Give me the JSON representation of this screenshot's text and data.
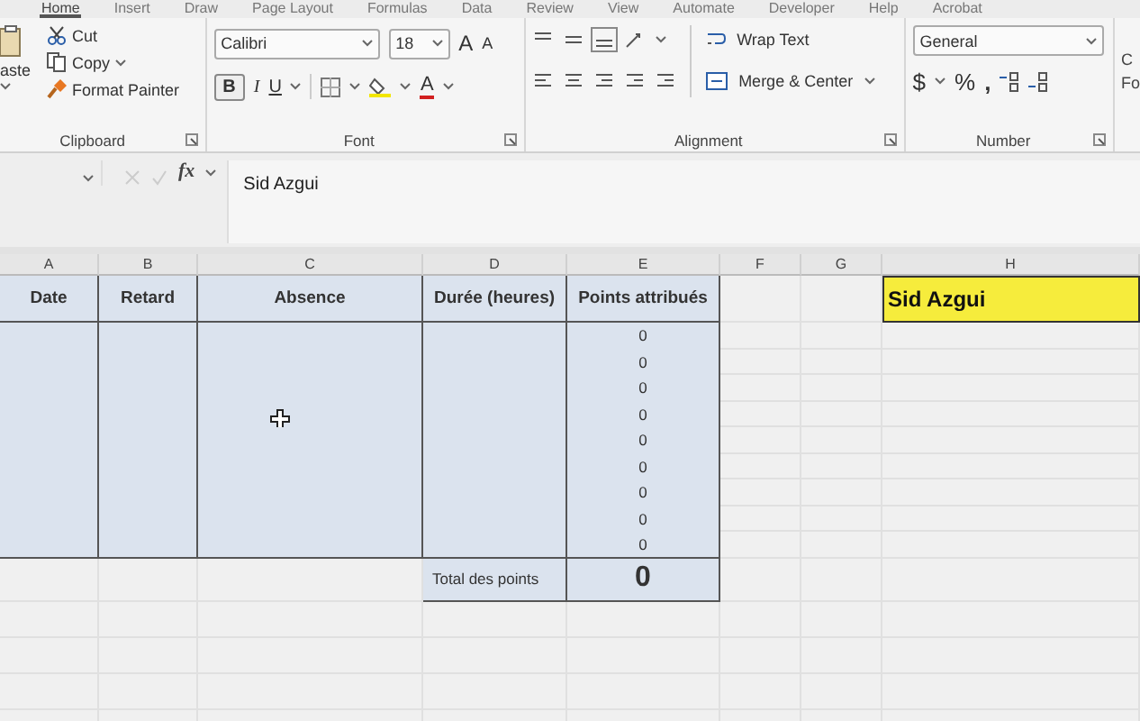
{
  "tabs": [
    {
      "label": "Home",
      "selected": true
    },
    {
      "label": "Insert",
      "selected": false
    },
    {
      "label": "Draw",
      "selected": false
    },
    {
      "label": "Page Layout",
      "selected": false
    },
    {
      "label": "Formulas",
      "selected": false
    },
    {
      "label": "Data",
      "selected": false
    },
    {
      "label": "Review",
      "selected": false
    },
    {
      "label": "View",
      "selected": false
    },
    {
      "label": "Automate",
      "selected": false
    },
    {
      "label": "Developer",
      "selected": false
    },
    {
      "label": "Help",
      "selected": false
    },
    {
      "label": "Acrobat",
      "selected": false
    }
  ],
  "clipboard": {
    "paste": "aste",
    "cut": "Cut",
    "copy": "Copy",
    "format_painter": "Format Painter",
    "label": "Clipboard"
  },
  "font": {
    "name": "Calibri",
    "size": "18",
    "grow": "A",
    "shrink": "A",
    "bold": "B",
    "italic": "I",
    "underline": "U",
    "font_color": "A",
    "label": "Font"
  },
  "alignment": {
    "wrap_text": "Wrap Text",
    "merge_center": "Merge & Center",
    "label": "Alignment"
  },
  "number": {
    "format": "General",
    "currency": "$",
    "percent": "%",
    "comma": ",",
    "label": "Number"
  },
  "cut_group": [
    "C",
    "Fo"
  ],
  "formula_bar": {
    "fx": "fx",
    "value": "Sid Azgui"
  },
  "sheet": {
    "columns": [
      "A",
      "B",
      "C",
      "D",
      "E",
      "F",
      "G",
      "H"
    ],
    "headers": [
      "Date",
      "Retard",
      "Absence",
      "Durée (heures)",
      "Points attribués"
    ],
    "points": [
      "0",
      "0",
      "0",
      "0",
      "0",
      "0",
      "0",
      "0",
      "0"
    ],
    "total_label": "Total des points",
    "total_value": "0",
    "name_cell": {
      "text": "Sid Azgui",
      "selected": true
    }
  }
}
